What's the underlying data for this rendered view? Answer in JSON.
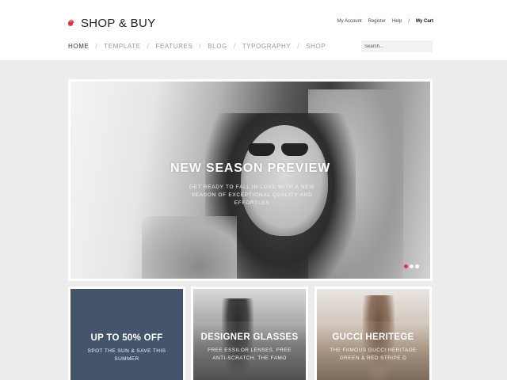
{
  "brand": {
    "name": "SHOP & BUY"
  },
  "account_links": [
    "My Account",
    "Register",
    "Help",
    "/",
    "My Cart"
  ],
  "nav": {
    "items": [
      "HOME",
      "TEMPLATE",
      "FEATURES",
      "BLOG",
      "TYPOGRAPHY",
      "SHOP"
    ],
    "active": "HOME",
    "separator": "/"
  },
  "search": {
    "placeholder": "Search..."
  },
  "hero": {
    "title": "NEW SEASON PREVIEW",
    "subtitle": "GET READY TO FALL IN LOVE WITH A NEW SEASON OF EXCEPTIONAL QUALITY AND EFFORTLES",
    "slides_total": 3,
    "active_slide": 1
  },
  "cards": [
    {
      "title": "UP TO 50% OFF",
      "text": "SPOT THE SUN & SAVE THIS SUMMER",
      "background": "#44546a"
    },
    {
      "title": "DESIGNER GLASSES",
      "text": "FREE ESSILOR LENSES. FREE ANTI-SCRATCH. THE FAMO"
    },
    {
      "title": "GUCCI HERITEGE",
      "text": "THE FAMOUS GUCCI HERITAGE GREEN & RED STRIPE D"
    }
  ],
  "colors": {
    "accent": "#e5333c",
    "page_background": "#ececec",
    "promo_card": "#44546a"
  },
  "icons": {
    "logo": "shopping-bag-icon"
  }
}
